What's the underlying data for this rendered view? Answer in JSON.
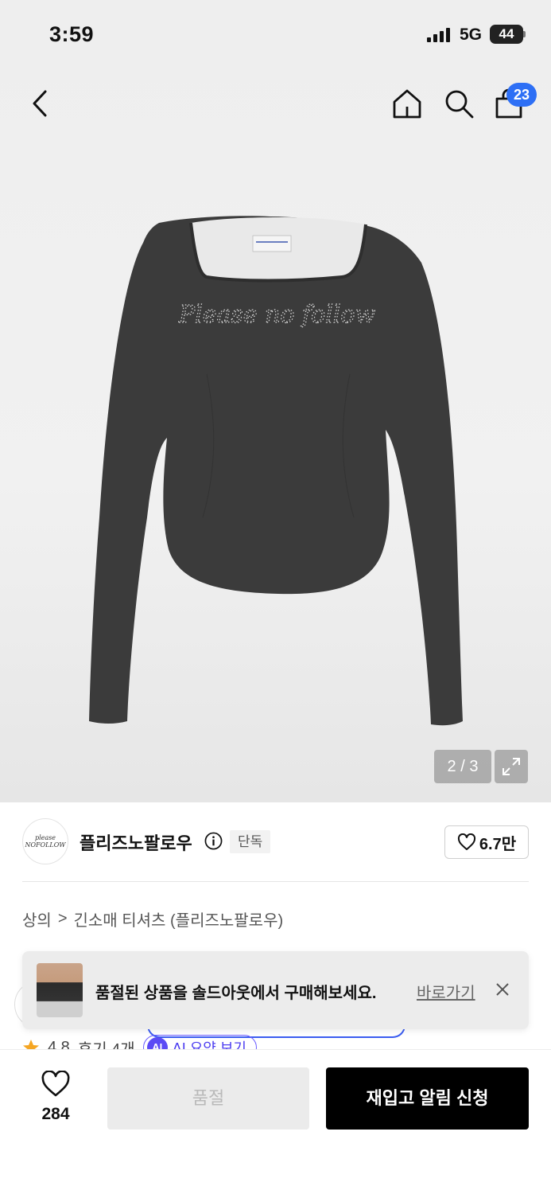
{
  "status_bar": {
    "time": "3:59",
    "network": "5G",
    "battery": "44"
  },
  "header": {
    "cart_count": "23"
  },
  "gallery": {
    "counter": "2 / 3"
  },
  "product_print": "Please no follow",
  "brand": {
    "logo_text": "please NOFOLLOW",
    "name": "플리즈노팔로우",
    "tag": "단독",
    "likes": "6.7만"
  },
  "breadcrumb": {
    "level1": "상의",
    "separator": ">",
    "level2": "긴소매 티셔츠 (플리즈노팔로우)"
  },
  "toast": {
    "message": "품절된 상품을 솔드아웃에서 구매해보세요.",
    "link": "바로가기"
  },
  "reviews": {
    "rating": "4.8",
    "count_label": "후기 4개",
    "ai_badge": "AI",
    "ai_label": "AI 요약 보기"
  },
  "bottom_bar": {
    "wish_count": "284",
    "soldout_label": "품절",
    "restock_label": "재입고 알림 신청"
  },
  "colors": {
    "accent_blue": "#2d6ff5",
    "ai_purple": "#5b4bf5",
    "primary_button": "#000000",
    "shirt": "#3b3b3b"
  },
  "icons": [
    "back-icon",
    "home-icon",
    "search-icon",
    "bag-icon",
    "expand-icon",
    "info-icon",
    "heart-icon",
    "close-icon",
    "star-icon"
  ]
}
